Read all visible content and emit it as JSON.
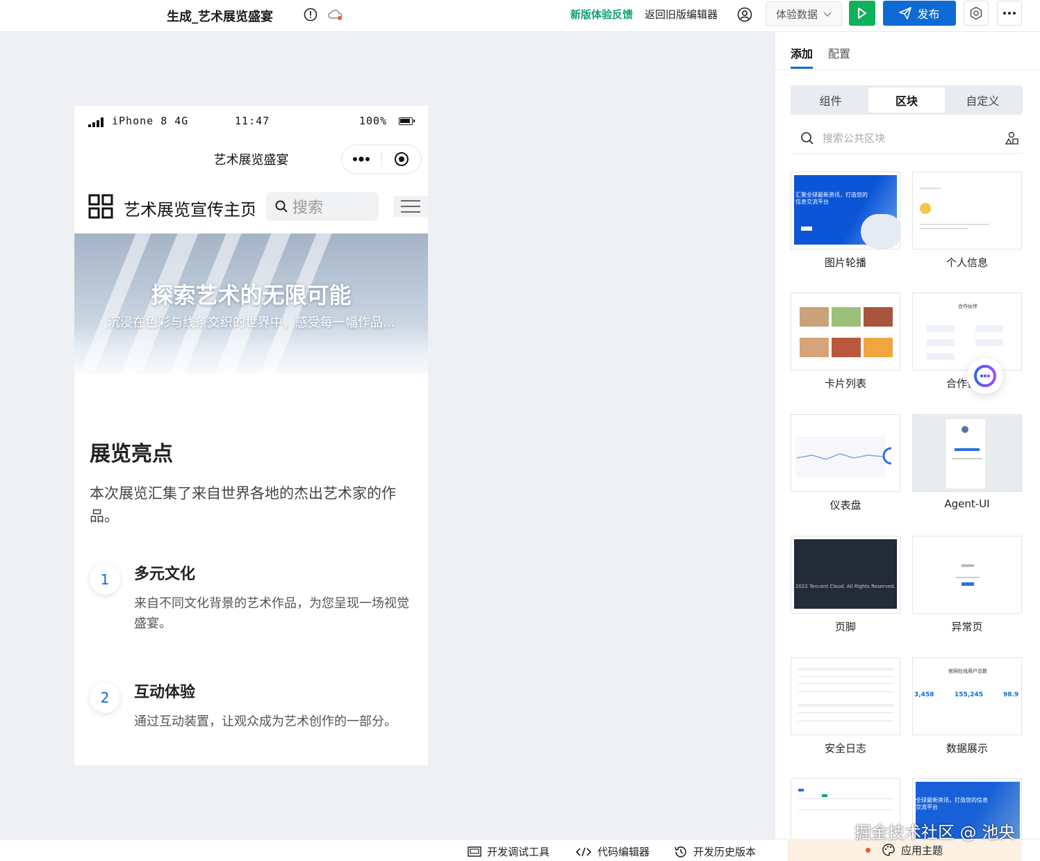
{
  "topbar": {
    "title": "生成_艺术展览盛宴",
    "feedback": "新版体验反馈",
    "old_editor": "返回旧版编辑器",
    "data_select": "体验数据",
    "publish": "发布"
  },
  "phone": {
    "status": {
      "carrier": "iPhone 8  4G",
      "time": "11:47",
      "battery": "100%"
    },
    "mp_title": "艺术展览盛宴",
    "site_name": "艺术展览宣传主页",
    "search_placeholder": "搜索",
    "hero": {
      "title": "探索艺术的无限可能",
      "subtitle": "沉浸在色彩与线条交织的世界中，感受每一幅作品..."
    },
    "section": {
      "title": "展览亮点",
      "desc": "本次展览汇集了来自世界各地的杰出艺术家的作品。"
    },
    "features": [
      {
        "num": "1",
        "title": "多元文化",
        "desc": "来自不同文化背景的艺术作品，为您呈现一场视觉盛宴。"
      },
      {
        "num": "2",
        "title": "互动体验",
        "desc": "通过互动装置，让观众成为艺术创作的一部分。"
      }
    ]
  },
  "panel": {
    "tabs": [
      "添加",
      "配置"
    ],
    "segments": [
      "组件",
      "区块",
      "自定义"
    ],
    "search_placeholder": "搜索公共区块",
    "cards": [
      {
        "label": "图片轮播",
        "thumb_text": "汇聚全球最新资讯，打造您的信息交流平台"
      },
      {
        "label": "个人信息"
      },
      {
        "label": "卡片列表"
      },
      {
        "label": "合作伙伴",
        "thumb_text": "合作伙伴"
      },
      {
        "label": "仪表盘"
      },
      {
        "label": "Agent-UI"
      },
      {
        "label": "页脚",
        "thumb_text": "2022 Tencent Cloud. All Rights Reserved."
      },
      {
        "label": "异常页"
      },
      {
        "label": "安全日志"
      },
      {
        "label": "数据展示",
        "thumb_text": "官网在线用户总数",
        "stats": [
          "3,458",
          "155,245",
          "98.9"
        ]
      },
      {
        "label": ""
      },
      {
        "label": "",
        "thumb_text": "全球最新资讯，打造您的信息交流平台"
      }
    ]
  },
  "bottombar": {
    "debug": "开发调试工具",
    "code": "代码编辑器",
    "history": "开发历史版本",
    "theme": "应用主题"
  },
  "watermark": "掘金技术社区 @ 池央",
  "colors": {
    "brand": "#0f6ad6",
    "run": "#0fb15b",
    "feedback": "#0fa36b"
  }
}
